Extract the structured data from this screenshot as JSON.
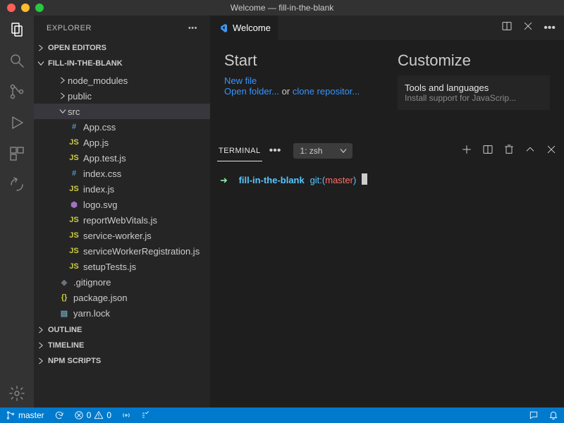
{
  "titlebar": {
    "title": "Welcome — fill-in-the-blank"
  },
  "sidebar": {
    "title": "EXPLORER",
    "sections": {
      "open_editors": "OPEN EDITORS",
      "project": "FILL-IN-THE-BLANK",
      "outline": "OUTLINE",
      "timeline": "TIMELINE",
      "npm": "NPM SCRIPTS"
    },
    "tree": [
      {
        "label": "node_modules",
        "kind": "folder",
        "expanded": false,
        "indent": 1
      },
      {
        "label": "public",
        "kind": "folder",
        "expanded": false,
        "indent": 1
      },
      {
        "label": "src",
        "kind": "folder",
        "expanded": true,
        "indent": 1,
        "selected": true
      },
      {
        "label": "App.css",
        "kind": "css",
        "indent": 2
      },
      {
        "label": "App.js",
        "kind": "js",
        "indent": 2
      },
      {
        "label": "App.test.js",
        "kind": "js",
        "indent": 2
      },
      {
        "label": "index.css",
        "kind": "css",
        "indent": 2
      },
      {
        "label": "index.js",
        "kind": "js",
        "indent": 2
      },
      {
        "label": "logo.svg",
        "kind": "svg",
        "indent": 2
      },
      {
        "label": "reportWebVitals.js",
        "kind": "js",
        "indent": 2
      },
      {
        "label": "service-worker.js",
        "kind": "js",
        "indent": 2
      },
      {
        "label": "serviceWorkerRegistration.js",
        "kind": "js",
        "indent": 2
      },
      {
        "label": "setupTests.js",
        "kind": "js",
        "indent": 2
      },
      {
        "label": ".gitignore",
        "kind": "git",
        "indent": 1
      },
      {
        "label": "package.json",
        "kind": "json",
        "indent": 1
      },
      {
        "label": "yarn.lock",
        "kind": "lock",
        "indent": 1
      }
    ]
  },
  "editor": {
    "tab_label": "Welcome",
    "start_heading": "Start",
    "customize_heading": "Customize",
    "new_file": "New file",
    "open_folder": "Open folder...",
    "or": " or ",
    "clone_repo": "clone repositor...",
    "cust_title": "Tools and languages",
    "cust_desc": "Install support for JavaScrip..."
  },
  "terminal": {
    "tab_label": "TERMINAL",
    "shell": "1: zsh",
    "prompt_dir": "fill-in-the-blank",
    "prompt_git": "git:",
    "prompt_branch": "master"
  },
  "statusbar": {
    "branch": "master",
    "sync": "",
    "errors": "0",
    "warnings": "0"
  }
}
